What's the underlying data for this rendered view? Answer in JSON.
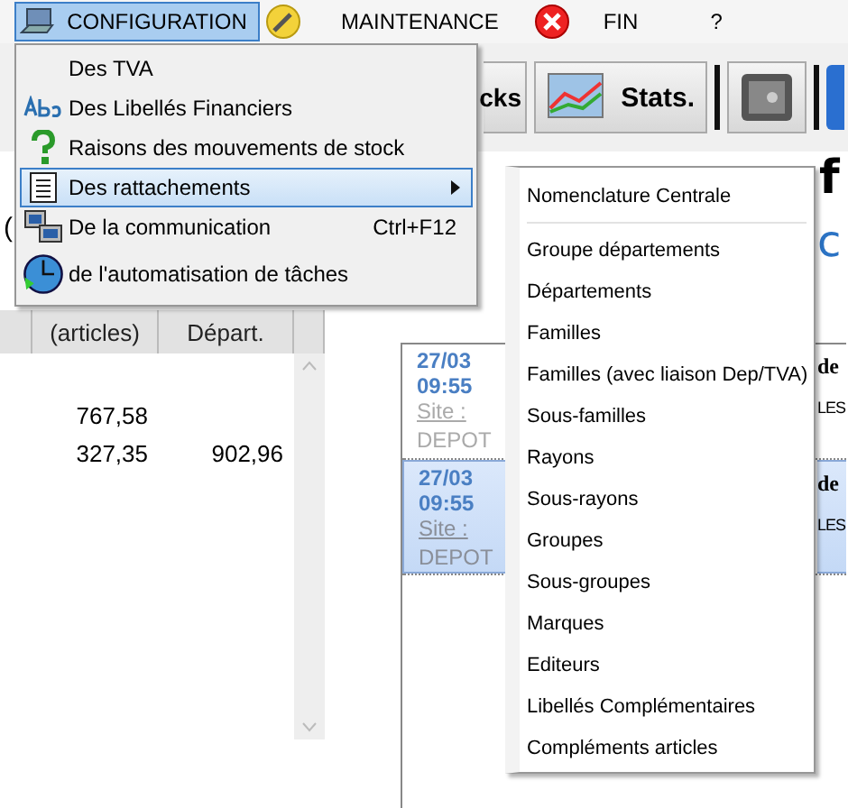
{
  "menubar": [
    {
      "label": "CONFIGURATION",
      "selected": true
    },
    {
      "label": "MAINTENANCE",
      "selected": false
    },
    {
      "label": "FIN",
      "selected": false
    },
    {
      "label": "?",
      "selected": false
    }
  ],
  "dropdown": {
    "items": [
      {
        "label": "Des TVA",
        "selected": false
      },
      {
        "label": "Des Libellés Financiers",
        "selected": false
      },
      {
        "label": "Raisons des mouvements de stock",
        "selected": false
      },
      {
        "label": "Des rattachements",
        "selected": true,
        "has_submenu": true
      },
      {
        "label": "De la communication",
        "shortcut": "Ctrl+F12",
        "selected": false
      },
      {
        "label": "de l'automatisation de tâches",
        "selected": false
      }
    ]
  },
  "submenu": {
    "items": [
      {
        "kind": "item",
        "label": "Nomenclature Centrale"
      },
      {
        "kind": "separator"
      },
      {
        "kind": "item",
        "label": "Groupe départements"
      },
      {
        "kind": "item",
        "label": "Départements"
      },
      {
        "kind": "item",
        "label": "Familles"
      },
      {
        "kind": "item",
        "label": "Familles (avec liaison Dep/TVA)"
      },
      {
        "kind": "item",
        "label": "Sous-familles"
      },
      {
        "kind": "item",
        "label": "Rayons"
      },
      {
        "kind": "item",
        "label": "Sous-rayons"
      },
      {
        "kind": "item",
        "label": "Groupes"
      },
      {
        "kind": "item",
        "label": "Sous-groupes"
      },
      {
        "kind": "item",
        "label": "Marques"
      },
      {
        "kind": "item",
        "label": "Editeurs"
      },
      {
        "kind": "item",
        "label": "Libellés Complémentaires"
      },
      {
        "kind": "item",
        "label": "Compléments articles"
      }
    ]
  },
  "toolbar": {
    "buttons": [
      {
        "kind": "text",
        "label": "cks"
      },
      {
        "kind": "chart",
        "label": "Stats."
      },
      {
        "kind": "safe"
      },
      {
        "kind": "edge"
      }
    ]
  },
  "header": {
    "partial_label": "(",
    "logo_text": "f",
    "heading": "c"
  },
  "grid": {
    "columns": [
      "(articles)",
      "Départ."
    ],
    "rows": [
      {
        "articles": "767,58"
      },
      {
        "articles": "327,35",
        "depart": "902,96"
      }
    ]
  },
  "cards": [
    {
      "date": "27/03",
      "time": "09:55",
      "site": "Site :",
      "depot": "DEPOT",
      "title": "de",
      "subtitle": "LES",
      "selected": false
    },
    {
      "date": "27/03",
      "time": "09:55",
      "site": "Site :",
      "depot": "DEPOT",
      "title": "de",
      "subtitle": "LES",
      "selected": true
    }
  ]
}
